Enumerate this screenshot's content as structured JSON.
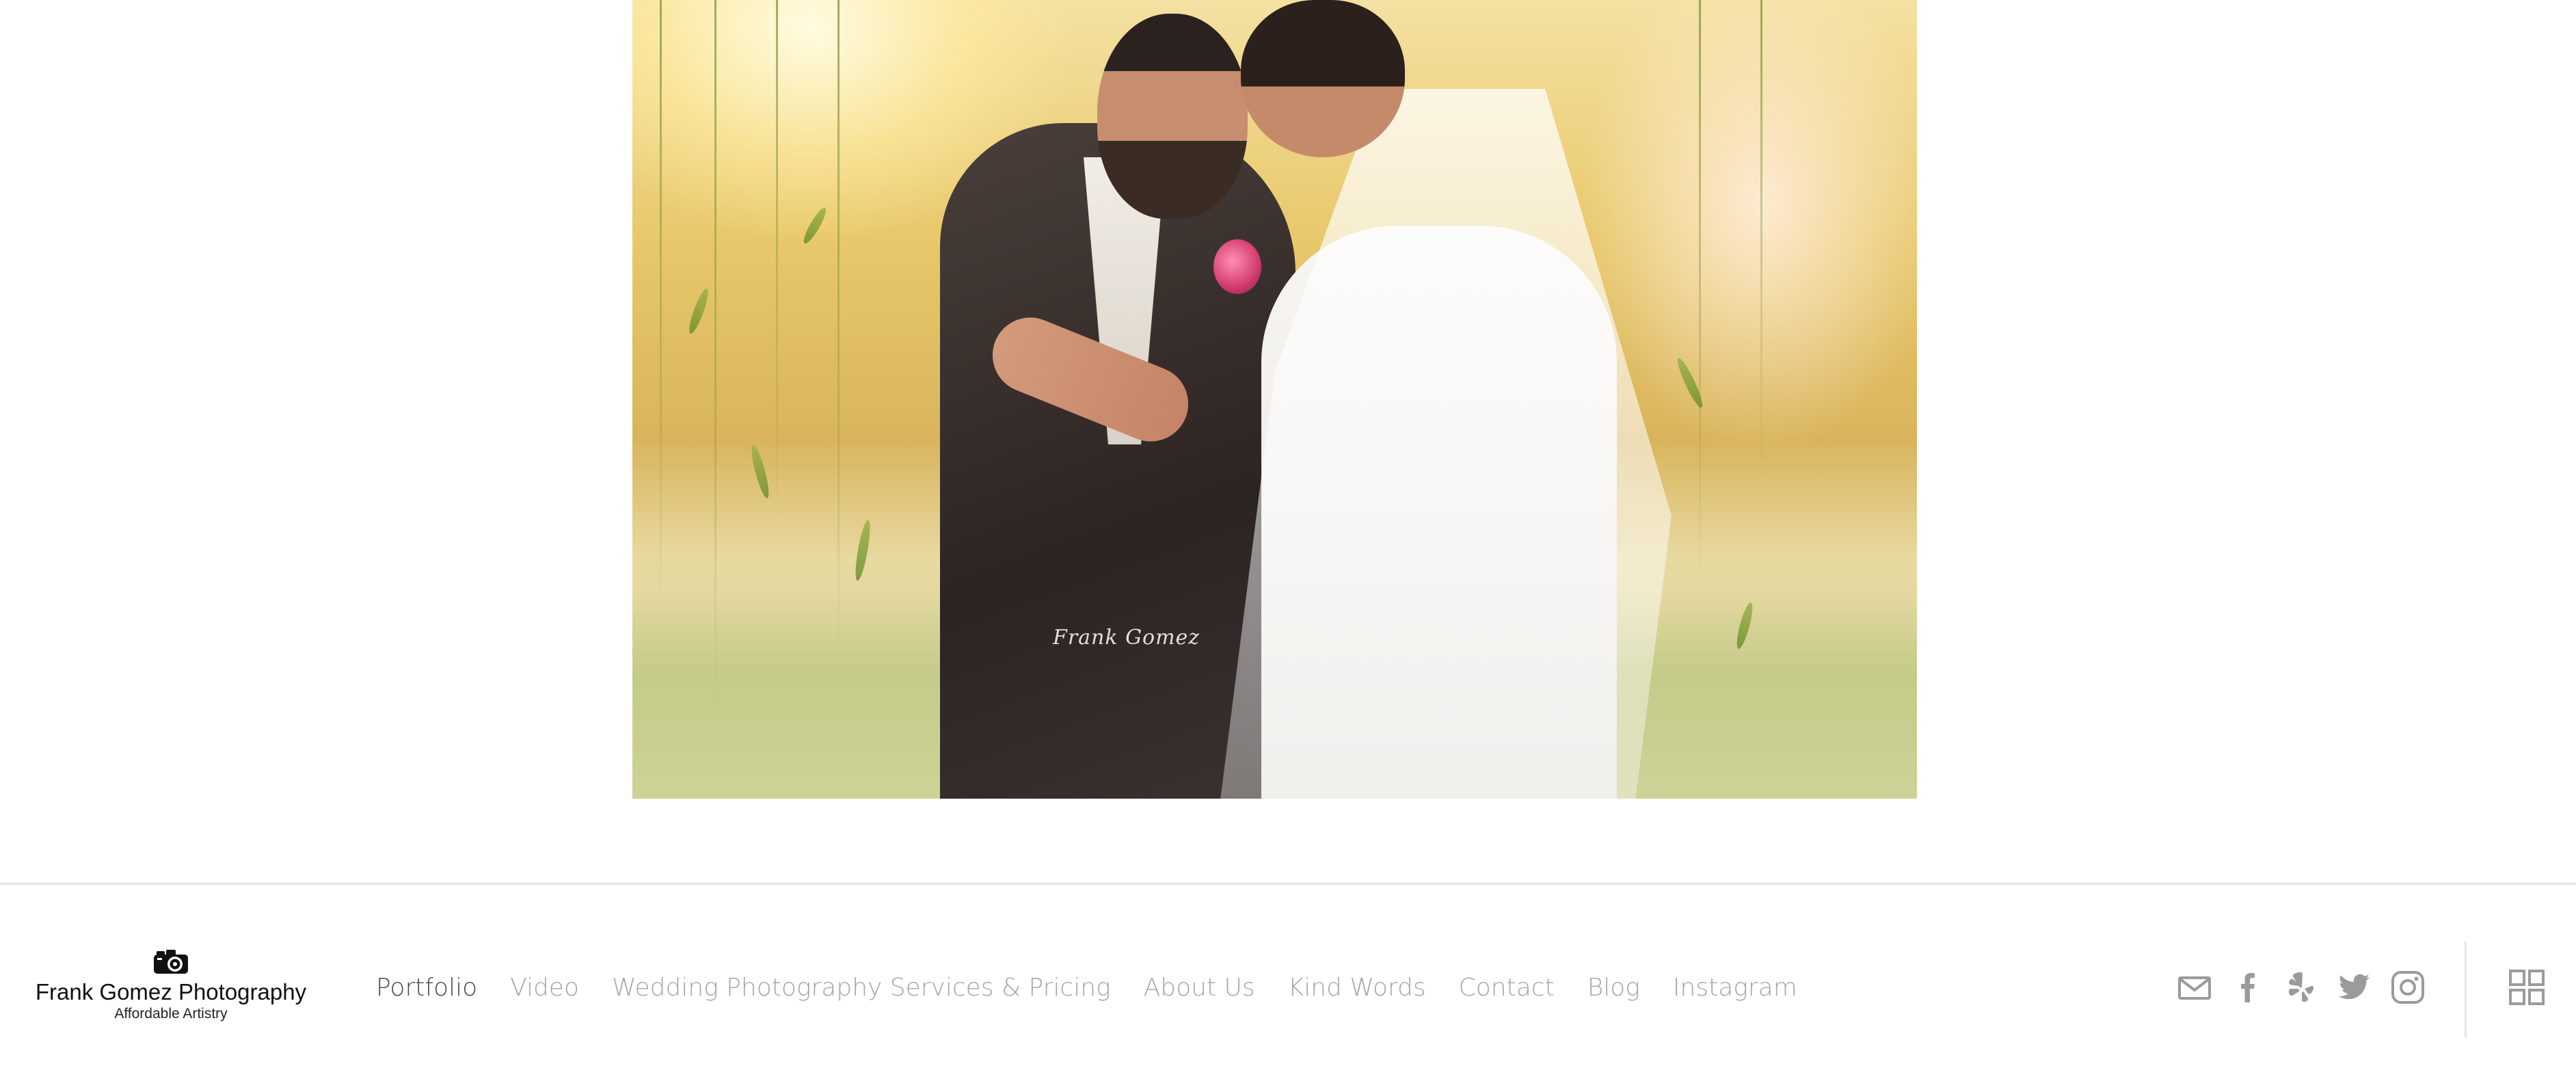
{
  "photo": {
    "alt": "",
    "watermark": "Frank Gomez"
  },
  "footer": {
    "brand": {
      "name": "Frank Gomez Photography",
      "tagline": "Affordable Artistry",
      "icon": "camera-icon"
    },
    "nav": [
      {
        "label": "Portfolio",
        "active": true
      },
      {
        "label": "Video",
        "active": false
      },
      {
        "label": "Wedding Photography Services & Pricing",
        "active": false
      },
      {
        "label": "About Us",
        "active": false
      },
      {
        "label": "Kind Words",
        "active": false
      },
      {
        "label": "Contact",
        "active": false
      },
      {
        "label": "Blog",
        "active": false
      },
      {
        "label": "Instagram",
        "active": false
      }
    ],
    "social": [
      {
        "icon": "email-icon"
      },
      {
        "icon": "facebook-icon"
      },
      {
        "icon": "yelp-icon"
      },
      {
        "icon": "twitter-icon"
      },
      {
        "icon": "instagram-icon"
      }
    ],
    "grid_icon": "grid-menu-icon"
  },
  "colors": {
    "nav_active": "#4b4b4b",
    "nav_inactive": "#a5a5a5",
    "icon_gray": "#9b9b9b",
    "divider": "#e4e4e4"
  }
}
